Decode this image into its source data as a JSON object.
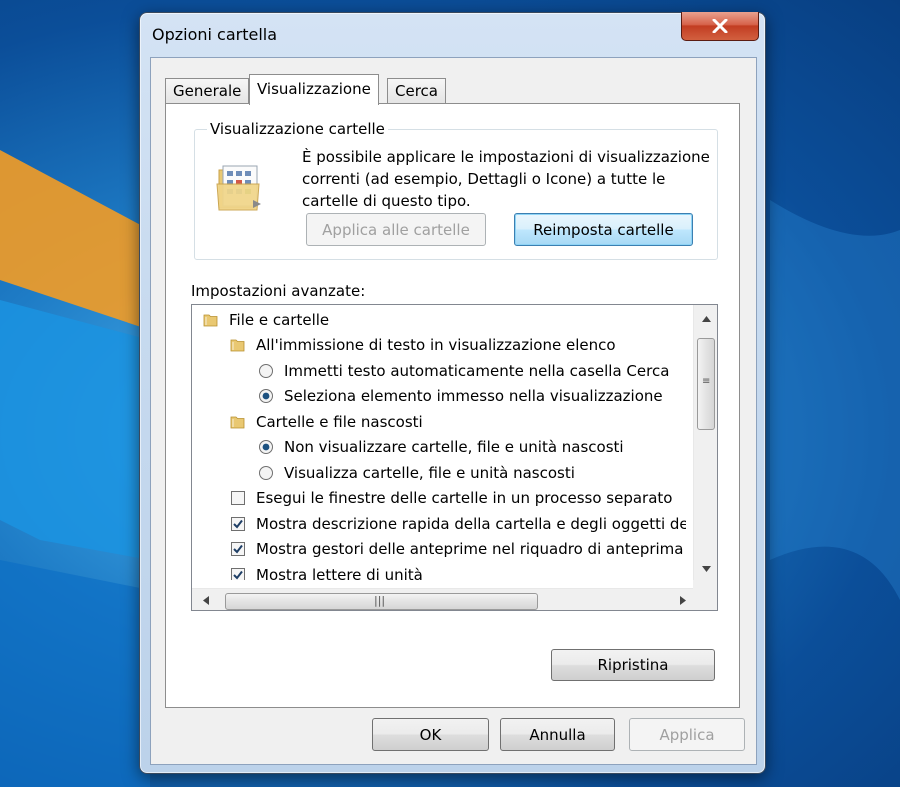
{
  "window": {
    "title": "Opzioni cartella"
  },
  "tabs": [
    {
      "label": "Generale",
      "active": false
    },
    {
      "label": "Visualizzazione",
      "active": true
    },
    {
      "label": "Cerca",
      "active": false
    }
  ],
  "folder_view": {
    "legend": "Visualizzazione cartelle",
    "description": "È possibile applicare le impostazioni di visualizzazione correnti (ad esempio, Dettagli o Icone) a tutte le cartelle di questo tipo.",
    "apply_button": "Applica alle cartelle",
    "reset_button": "Reimposta cartelle"
  },
  "advanced": {
    "label": "Impostazioni avanzate:",
    "items": [
      {
        "type": "folder",
        "level": 0,
        "label": "File e cartelle"
      },
      {
        "type": "folder",
        "level": 1,
        "label": "All'immissione di testo in visualizzazione elenco"
      },
      {
        "type": "radio",
        "level": 2,
        "checked": false,
        "label": "Immetti testo automaticamente nella casella Cerca"
      },
      {
        "type": "radio",
        "level": 2,
        "checked": true,
        "label": "Seleziona elemento immesso nella visualizzazione"
      },
      {
        "type": "folder",
        "level": 1,
        "label": "Cartelle e file nascosti"
      },
      {
        "type": "radio",
        "level": 2,
        "checked": true,
        "label": "Non visualizzare cartelle, file e unità nascosti"
      },
      {
        "type": "radio",
        "level": 2,
        "checked": false,
        "label": "Visualizza cartelle, file e unità nascosti"
      },
      {
        "type": "checkbox",
        "level": 1,
        "checked": false,
        "label": "Esegui le finestre delle cartelle in un processo separato"
      },
      {
        "type": "checkbox",
        "level": 1,
        "checked": true,
        "label": "Mostra descrizione rapida della cartella e degli oggetti del"
      },
      {
        "type": "checkbox",
        "level": 1,
        "checked": true,
        "label": "Mostra gestori delle anteprime nel riquadro di anteprima"
      },
      {
        "type": "checkbox",
        "level": 1,
        "checked": true,
        "label": "Mostra lettere di unità"
      }
    ]
  },
  "restore_button": "Ripristina",
  "footer": {
    "ok": "OK",
    "cancel": "Annulla",
    "apply": "Applica"
  },
  "colors": {
    "accent": "#3c7fb1",
    "close_red": "#c23d22",
    "radio_dot": "#1c5180"
  }
}
